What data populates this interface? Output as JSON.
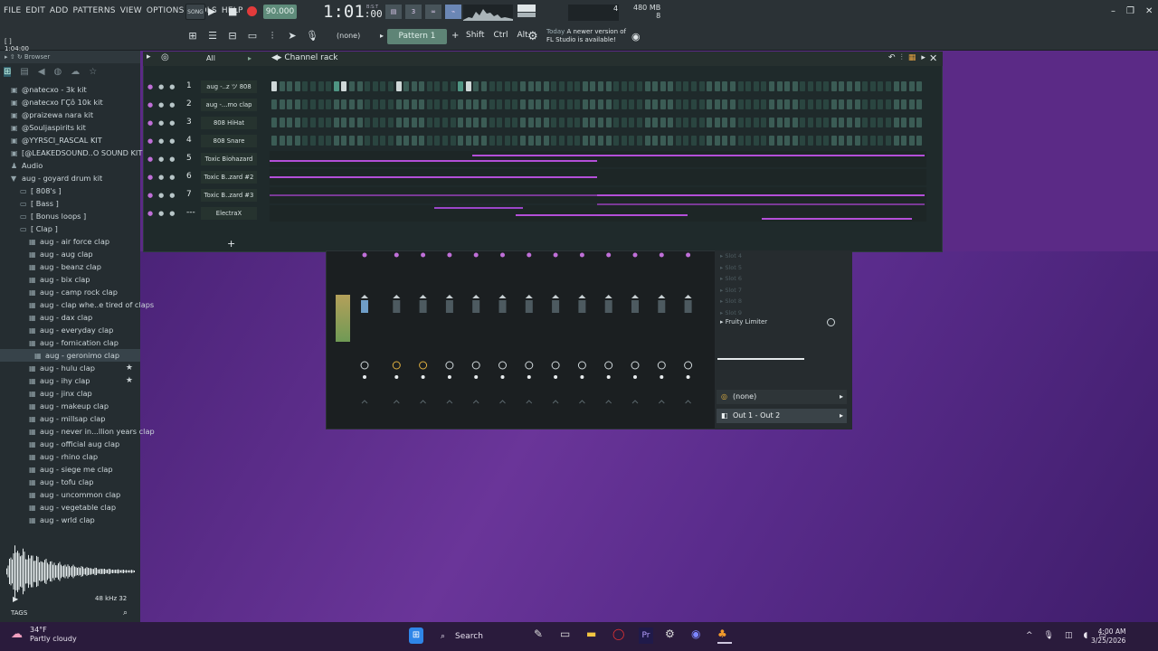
{
  "menu": [
    "FILE",
    "EDIT",
    "ADD",
    "PATTERNS",
    "VIEW",
    "OPTIONS",
    "TOOLS",
    "HELP"
  ],
  "transport": {
    "song_label": "SONG",
    "tempo": "90.000",
    "time": "1:01",
    "time_sub": ":00",
    "time_unit": "B:S:T"
  },
  "memory": {
    "mb": "480 MB",
    "count": "8",
    "cpu_val": "4"
  },
  "hint": {
    "line1": "[  ]",
    "line2": "1:04:00"
  },
  "toolbar": {
    "pattern_select": "(none)",
    "pattern": "Pattern 1",
    "kbd": [
      "Shift",
      "Ctrl",
      "Alt"
    ],
    "news_date": "Today",
    "news_text": "A newer version of",
    "news_text2": "FL Studio is available!"
  },
  "browser": {
    "title": "Browser",
    "items": [
      {
        "label": "@natecxo - 3k kit",
        "glyph": "▣",
        "indent": 0
      },
      {
        "label": "@natecxo ГÇô 10k kit",
        "glyph": "▣",
        "indent": 0
      },
      {
        "label": "@praizewa nara kit",
        "glyph": "▣",
        "indent": 0
      },
      {
        "label": "@Souljaspirits kit",
        "glyph": "▣",
        "indent": 0
      },
      {
        "label": "@YYRSCI_RASCAL KIT",
        "glyph": "▣",
        "indent": 0
      },
      {
        "label": "[@LEAKEDSOUND..O SOUND KIT",
        "glyph": "▣",
        "indent": 0
      },
      {
        "label": "Audio",
        "glyph": "♟",
        "indent": 0
      },
      {
        "label": "aug - goyard drum kit",
        "glyph": "▼",
        "indent": 0
      },
      {
        "label": "[ 808's ]",
        "glyph": "▭",
        "indent": 1
      },
      {
        "label": "[ Bass ]",
        "glyph": "▭",
        "indent": 1
      },
      {
        "label": "[ Bonus loops ]",
        "glyph": "▭",
        "indent": 1
      },
      {
        "label": "[ Clap ]",
        "glyph": "▭",
        "indent": 1
      },
      {
        "label": "aug - air force clap",
        "glyph": "▦",
        "indent": 2
      },
      {
        "label": "aug - aug clap",
        "glyph": "▦",
        "indent": 2
      },
      {
        "label": "aug - beanz clap",
        "glyph": "▦",
        "indent": 2
      },
      {
        "label": "aug - bix clap",
        "glyph": "▦",
        "indent": 2
      },
      {
        "label": "aug - camp rock clap",
        "glyph": "▦",
        "indent": 2
      },
      {
        "label": "aug - clap whe..e tired of claps",
        "glyph": "▦",
        "indent": 2
      },
      {
        "label": "aug - dax clap",
        "glyph": "▦",
        "indent": 2
      },
      {
        "label": "aug - everyday clap",
        "glyph": "▦",
        "indent": 2
      },
      {
        "label": "aug - fornication clap",
        "glyph": "▦",
        "indent": 2
      },
      {
        "label": "aug - geronimo clap",
        "glyph": "▦",
        "indent": 3
      },
      {
        "label": "aug - hulu clap",
        "glyph": "▦",
        "indent": 2,
        "star": true
      },
      {
        "label": "aug - ihy clap",
        "glyph": "▦",
        "indent": 2,
        "star": true
      },
      {
        "label": "aug - jinx clap",
        "glyph": "▦",
        "indent": 2
      },
      {
        "label": "aug - makeup clap",
        "glyph": "▦",
        "indent": 2
      },
      {
        "label": "aug - millsap clap",
        "glyph": "▦",
        "indent": 2
      },
      {
        "label": "aug - never in...llion years clap",
        "glyph": "▦",
        "indent": 2
      },
      {
        "label": "aug - official aug clap",
        "glyph": "▦",
        "indent": 2
      },
      {
        "label": "aug - rhino clap",
        "glyph": "▦",
        "indent": 2
      },
      {
        "label": "aug - siege me clap",
        "glyph": "▦",
        "indent": 2
      },
      {
        "label": "aug - tofu clap",
        "glyph": "▦",
        "indent": 2
      },
      {
        "label": "aug - uncommon clap",
        "glyph": "▦",
        "indent": 2
      },
      {
        "label": "aug - vegetable clap",
        "glyph": "▦",
        "indent": 2
      },
      {
        "label": "aug - wrld clap",
        "glyph": "▦",
        "indent": 2
      }
    ],
    "selected_index": 21,
    "sample_rate": "48 kHz 32",
    "tags": "TAGS"
  },
  "channel_rack": {
    "title": "Channel rack",
    "filter": "All",
    "channels": [
      {
        "num": "1",
        "name": "aug -..z ツ 808",
        "kind": "steps",
        "pattern": "1000000001000000100000000100000000000000000000000000000000000000000000000000000000000000",
        "lit": [
          8,
          24
        ]
      },
      {
        "num": "2",
        "name": "aug -...mo clap",
        "kind": "steps",
        "pattern": "0000000000000000000000000000000000000000000000000000000000000000000000000000000000000000",
        "lit": []
      },
      {
        "num": "3",
        "name": "808 HiHat",
        "kind": "steps",
        "pattern": "0000000000000000000000000000000000000000000000000000000000000000000000000000000000000000",
        "lit": []
      },
      {
        "num": "4",
        "name": "808 Snare",
        "kind": "steps",
        "pattern": "0000000000000000000000000000000000000000000000000000000000000000000000000000000000000000",
        "lit": []
      },
      {
        "num": "5",
        "name": "Toxic Biohazard",
        "kind": "piano"
      },
      {
        "num": "6",
        "name": "Toxic B..zard #2",
        "kind": "piano"
      },
      {
        "num": "7",
        "name": "Toxic B..zard #3",
        "kind": "piano"
      },
      {
        "num": "---",
        "name": "ElectraX",
        "kind": "piano"
      }
    ]
  },
  "mixer": {
    "slots": [
      "Slot 4",
      "Slot 5",
      "Slot 6",
      "Slot 7",
      "Slot 8",
      "Slot 9"
    ],
    "limiter": "Fruity Limiter",
    "input": "(none)",
    "output": "Out 1 - Out 2"
  },
  "taskbar": {
    "temp": "34°F",
    "weather": "Partly cloudy",
    "search": "Search",
    "time": "4:00 AM",
    "date": "3/25/2026"
  },
  "colors": {
    "accent": "#5f8c7b",
    "pianoroll": "#b44fd8",
    "record": "#e23b3b"
  }
}
